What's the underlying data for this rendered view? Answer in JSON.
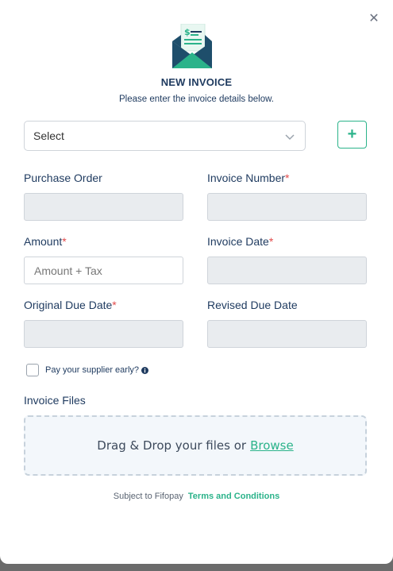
{
  "dialog": {
    "close_symbol": "✕",
    "icon": "invoice-envelope-icon",
    "title": "NEW INVOICE",
    "subtitle": "Please enter the invoice details below."
  },
  "supplier_select": {
    "value": "Select",
    "add_label": "+"
  },
  "fields": {
    "purchase_order": {
      "label": "Purchase Order",
      "required": false,
      "value": ""
    },
    "invoice_number": {
      "label": "Invoice Number",
      "required": true,
      "value": ""
    },
    "amount": {
      "label": "Amount",
      "required": true,
      "placeholder": "Amount + Tax",
      "value": ""
    },
    "invoice_date": {
      "label": "Invoice Date",
      "required": true,
      "value": ""
    },
    "original_due_date": {
      "label": "Original Due Date",
      "required": true,
      "value": ""
    },
    "revised_due_date": {
      "label": "Revised Due Date",
      "required": false,
      "value": ""
    },
    "required_marker": "*"
  },
  "early_payment": {
    "label": "Pay your supplier early?",
    "checked": false,
    "icon": "info-icon"
  },
  "files": {
    "label": "Invoice Files",
    "dropzone_text": "Drag & Drop your files or",
    "browse_label": "Browse"
  },
  "footer": {
    "text": "Subject to Fifopay",
    "terms_label": "Terms and Conditions"
  },
  "colors": {
    "accent": "#2bb38a",
    "heading": "#1e3a5f",
    "required": "#e24b4b",
    "disabled_field": "#e9ecef"
  }
}
